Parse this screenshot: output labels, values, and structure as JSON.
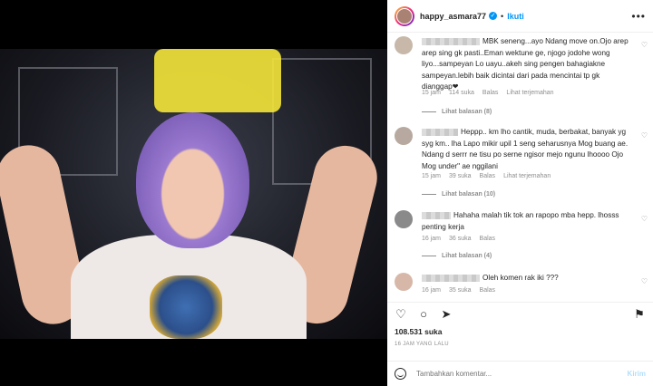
{
  "post": {
    "username": "happy_asmara77",
    "follow_label": "Ikuti",
    "separator": "•",
    "more_label": "•••"
  },
  "comments": [
    {
      "text": "MBK seneng...ayo Ndang move on.Ojo arep arep sing gk pasti..Eman wektune ge, njogo jodohe wong liyo...sampeyan Lo uayu..akeh sing pengen bahagiakne sampeyan.lebih baik dicintai dari pada mencintai tp gk dianggap❤",
      "time": "15 jam",
      "likes": "114 suka",
      "reply": "Balas",
      "translate": "Lihat terjemahan",
      "replies": "Lihat balasan (8)"
    },
    {
      "text": "Heppp.. km lho cantik, muda, berbakat, banyak yg syg km.. lha Lapo mikir upil 1 seng seharusnya Mog buang ae. Ndang d serrr ne tisu po serne ngisor mejo ngunu lhoooo Ojo Mog under\" ae nggilani",
      "time": "15 jam",
      "likes": "39 suka",
      "reply": "Balas",
      "translate": "Lihat terjemahan",
      "replies": "Lihat balasan (10)"
    },
    {
      "text": "Hahaha malah tik tok an rapopo mba hepp. lhosss penting kerja",
      "time": "16 jam",
      "likes": "36 suka",
      "reply": "Balas",
      "replies": "Lihat balasan (4)"
    },
    {
      "text": "Oleh komen rak iki ???",
      "time": "16 jam",
      "likes": "35 suka",
      "reply": "Balas"
    }
  ],
  "footer": {
    "likes": "108.531 suka",
    "time_ago": "16 JAM YANG LALU",
    "add_comment_placeholder": "Tambahkan komentar...",
    "send_label": "Kirim"
  },
  "icons": {
    "heart": "♡",
    "comment": "○",
    "share": "➤",
    "bookmark": "⚑"
  },
  "colors": {
    "link_blue": "#0095f6",
    "send_disabled": "#b2dffc",
    "meta_gray": "#8e8e8e"
  }
}
